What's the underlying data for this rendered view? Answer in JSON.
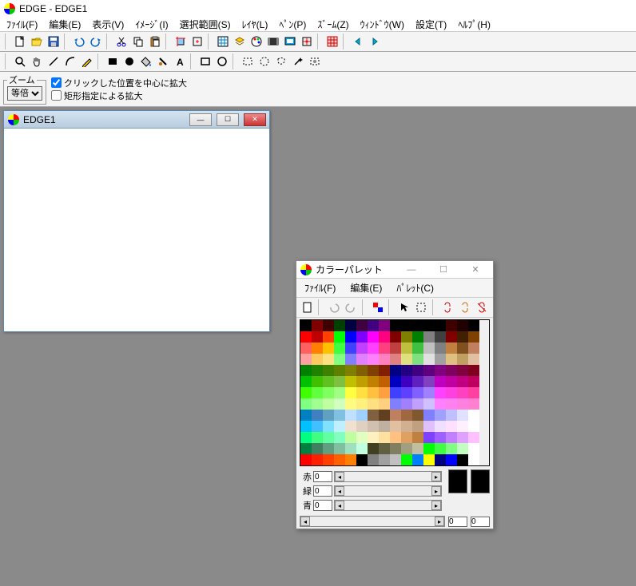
{
  "app": {
    "title": "EDGE - EDGE1"
  },
  "menus": [
    "ﾌｧｲﾙ(F)",
    "編集(E)",
    "表示(V)",
    "ｲﾒｰｼﾞ(I)",
    "選択範囲(S)",
    "ﾚｲﾔ(L)",
    "ﾍﾟﾝ(P)",
    "ｽﾞｰﾑ(Z)",
    "ｳｨﾝﾄﾞｳ(W)",
    "設定(T)",
    "ﾍﾙﾌﾟ(H)"
  ],
  "zoom": {
    "legend": "ズーム",
    "select": "等倍",
    "opt1": "クリックした位置を中心に拡大",
    "opt2": "矩形指定による拡大"
  },
  "edge1": {
    "title": "EDGE1"
  },
  "palette": {
    "title": "カラーパレット",
    "menus": [
      "ﾌｧｲﾙ(F)",
      "編集(E)",
      "ﾊﾟﾚｯﾄ(C)"
    ],
    "rgb": {
      "r_label": "赤",
      "g_label": "緑",
      "b_label": "青",
      "r": "0",
      "g": "0",
      "b": "0"
    },
    "extra_vals": [
      "0",
      "0"
    ],
    "gridColors": [
      "#000000",
      "#800000",
      "#400000",
      "#004000",
      "#000040",
      "#400040",
      "#400080",
      "#800080",
      "#000000",
      "#000000",
      "#000000",
      "#000000",
      "#000000",
      "#400000",
      "#200000",
      "#000000",
      "#ff0000",
      "#c00000",
      "#ff4000",
      "#00ff00",
      "#0000ff",
      "#8000ff",
      "#ff00ff",
      "#ff0080",
      "#800000",
      "#808000",
      "#008000",
      "#808080",
      "#404040",
      "#800000",
      "#402000",
      "#804000",
      "#ff6060",
      "#ff8000",
      "#ffc000",
      "#40ff40",
      "#4040ff",
      "#c040ff",
      "#ff40ff",
      "#ff4080",
      "#c04040",
      "#c0c040",
      "#40c040",
      "#c0c0c0",
      "#808080",
      "#c08040",
      "#805020",
      "#c08060",
      "#ffa0a0",
      "#ffc860",
      "#ffe080",
      "#80ff80",
      "#8080ff",
      "#e080ff",
      "#ff80ff",
      "#ff80c0",
      "#e08080",
      "#e0e080",
      "#80e080",
      "#e0e0e0",
      "#a0a0a0",
      "#e0c080",
      "#c0a060",
      "#e0c0a0",
      "#008000",
      "#208000",
      "#408000",
      "#608000",
      "#808000",
      "#806000",
      "#804000",
      "#802000",
      "#000080",
      "#200080",
      "#400080",
      "#600080",
      "#800080",
      "#800060",
      "#800040",
      "#800020",
      "#00c000",
      "#40c000",
      "#60c020",
      "#80c040",
      "#c0c000",
      "#c0a000",
      "#c08000",
      "#c06000",
      "#0000c0",
      "#4000c0",
      "#6020c0",
      "#8040c0",
      "#c000c0",
      "#c000a0",
      "#c00080",
      "#c00060",
      "#40ff00",
      "#60ff40",
      "#80ff60",
      "#a0ff80",
      "#ffff40",
      "#ffe040",
      "#ffc040",
      "#ffa040",
      "#4040ff",
      "#6040ff",
      "#8060ff",
      "#a080ff",
      "#ff40ff",
      "#ff40e0",
      "#ff40c0",
      "#ff40a0",
      "#80ff80",
      "#a0ff90",
      "#c0ffa0",
      "#d0ffc0",
      "#fffa80",
      "#fff080",
      "#ffe080",
      "#ffd080",
      "#8080ff",
      "#a080ff",
      "#c0a0ff",
      "#d0c0ff",
      "#ff80ff",
      "#ff80f0",
      "#ff80e0",
      "#ff80d0",
      "#0080c0",
      "#4080c0",
      "#60a0c0",
      "#80c0e0",
      "#c0e0ff",
      "#a0d0ff",
      "#806040",
      "#604020",
      "#c08060",
      "#a06840",
      "#805830",
      "#8080ff",
      "#a0a0ff",
      "#c0c0ff",
      "#e0e0ff",
      "#ffffff",
      "#00c0ff",
      "#40c0ff",
      "#80e0ff",
      "#c0f0ff",
      "#f0e0d0",
      "#e0d0c0",
      "#d0c0b0",
      "#c0b0a0",
      "#e0c0a0",
      "#d0b090",
      "#c0a080",
      "#e0c0ff",
      "#f0e0ff",
      "#ffe0ff",
      "#fff0ff",
      "#ffffff",
      "#00ff80",
      "#40ff80",
      "#60ffa0",
      "#80ffc0",
      "#c0ffa0",
      "#e0ffc0",
      "#fff0c0",
      "#ffe0a0",
      "#ffc080",
      "#e0a060",
      "#c08040",
      "#8040ff",
      "#a060ff",
      "#c080ff",
      "#e0a0ff",
      "#ffc0ff",
      "#008040",
      "#408060",
      "#60a080",
      "#80c0a0",
      "#a0e0c0",
      "#c0ffe0",
      "#404020",
      "#606040",
      "#808060",
      "#a0a080",
      "#c0c0a0",
      "#00ff00",
      "#40ff40",
      "#80ff80",
      "#c0ffc0",
      "#ffffff",
      "#ff0000",
      "#ff2000",
      "#ff4000",
      "#ff6000",
      "#ff8000",
      "#000000",
      "#808080",
      "#a0a0a0",
      "#c0c0c0",
      "#00ff00",
      "#0080ff",
      "#ffff00",
      "#000080",
      "#0000ff",
      "#000000",
      "#ffffff"
    ]
  }
}
